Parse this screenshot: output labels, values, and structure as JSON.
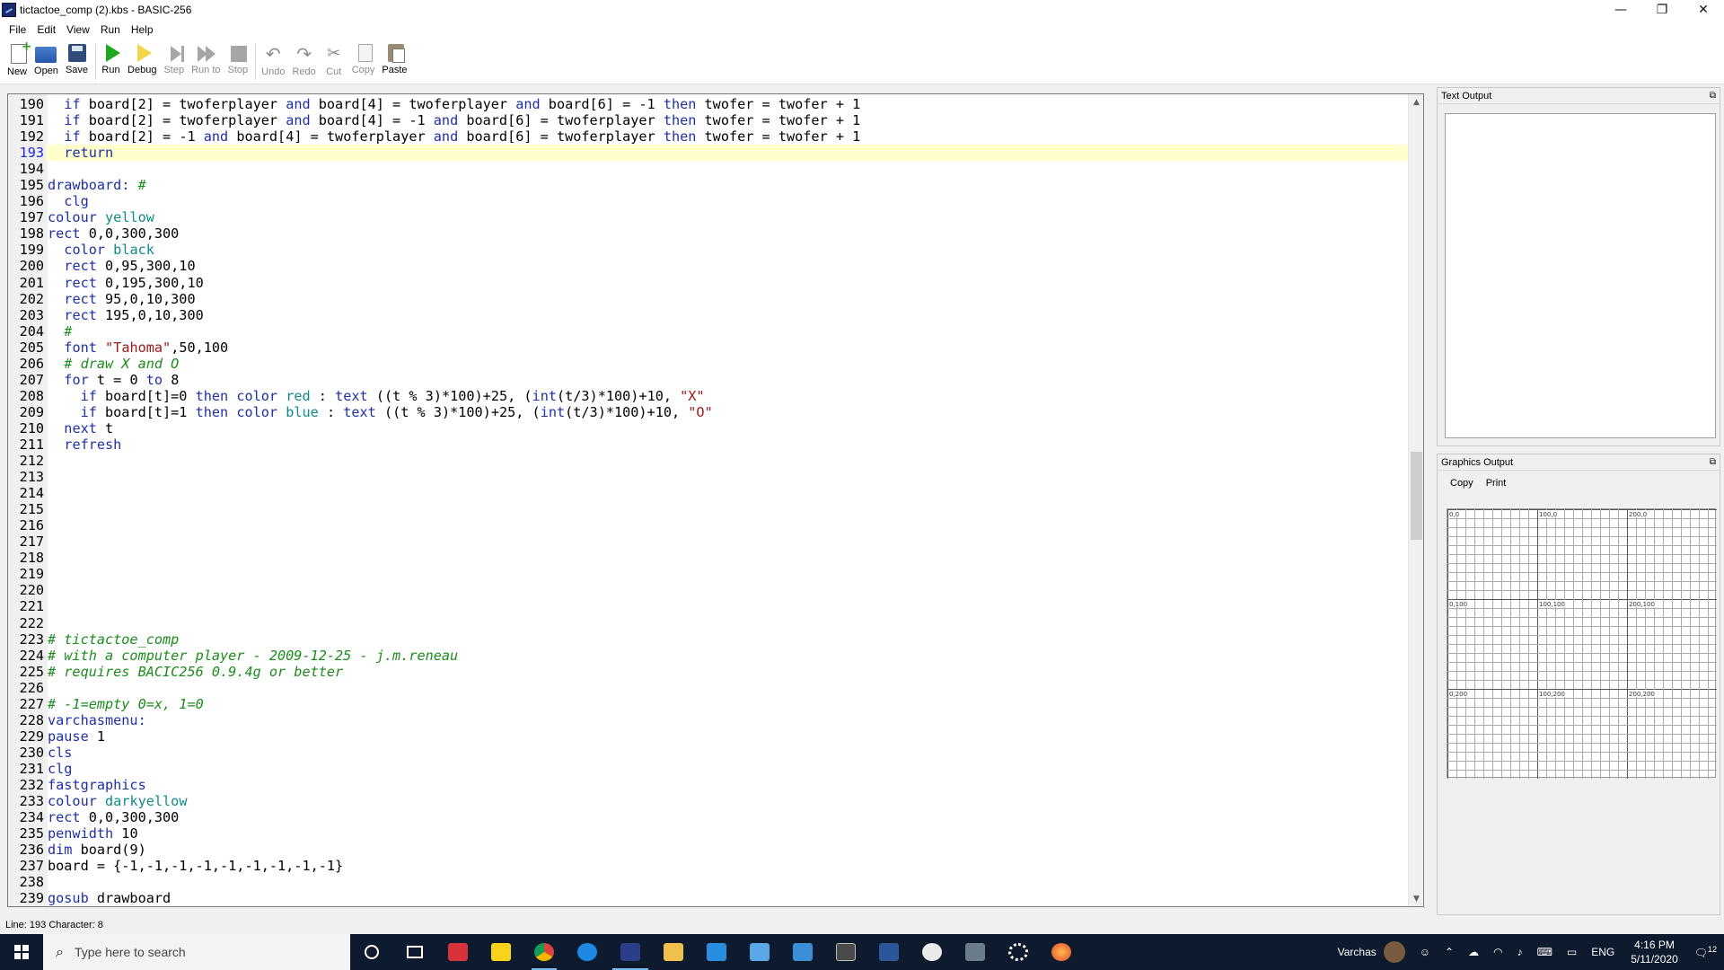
{
  "window": {
    "title": "tictactoe_comp (2).kbs - BASIC-256",
    "controls": [
      "—",
      "❐",
      "✕"
    ]
  },
  "menu": [
    "File",
    "Edit",
    "View",
    "Run",
    "Help"
  ],
  "toolbar": {
    "new": "New",
    "open": "Open",
    "save": "Save",
    "run": "Run",
    "debug": "Debug",
    "step": "Step",
    "run_to": "Run to",
    "stop": "Stop",
    "undo": "Undo",
    "redo": "Redo",
    "cut": "Cut",
    "copy": "Copy",
    "paste": "Paste"
  },
  "editor": {
    "current_line": 193,
    "lines": [
      {
        "n": "190",
        "code": [
          [
            "  ",
            ""
          ],
          [
            "if",
            "kw"
          ],
          [
            " board[2] = twoferplayer ",
            ""
          ],
          [
            "and",
            "kw"
          ],
          [
            " board[4] = twoferplayer ",
            ""
          ],
          [
            "and",
            "kw"
          ],
          [
            " board[6] = -1 ",
            ""
          ],
          [
            "then",
            "kw"
          ],
          [
            " twofer = twofer + 1",
            ""
          ]
        ]
      },
      {
        "n": "191",
        "code": [
          [
            "  ",
            ""
          ],
          [
            "if",
            "kw"
          ],
          [
            " board[2] = twoferplayer ",
            ""
          ],
          [
            "and",
            "kw"
          ],
          [
            " board[4] = -1 ",
            ""
          ],
          [
            "and",
            "kw"
          ],
          [
            " board[6] = twoferplayer ",
            ""
          ],
          [
            "then",
            "kw"
          ],
          [
            " twofer = twofer + 1",
            ""
          ]
        ]
      },
      {
        "n": "192",
        "code": [
          [
            "  ",
            ""
          ],
          [
            "if",
            "kw"
          ],
          [
            " board[2] = -1 ",
            ""
          ],
          [
            "and",
            "kw"
          ],
          [
            " board[4] = twoferplayer ",
            ""
          ],
          [
            "and",
            "kw"
          ],
          [
            " board[6] = twoferplayer ",
            ""
          ],
          [
            "then",
            "kw"
          ],
          [
            " twofer = twofer + 1",
            ""
          ]
        ]
      },
      {
        "n": "193",
        "code": [
          [
            "  ",
            ""
          ],
          [
            "return",
            "kw"
          ]
        ]
      },
      {
        "n": "194",
        "code": []
      },
      {
        "n": "195",
        "code": [
          [
            "drawboard:",
            "lb"
          ],
          [
            " ",
            ""
          ],
          [
            "#",
            "cm"
          ]
        ]
      },
      {
        "n": "196",
        "code": [
          [
            "  ",
            ""
          ],
          [
            "clg",
            "kw"
          ]
        ]
      },
      {
        "n": "197",
        "code": [
          [
            "colour",
            "kw"
          ],
          [
            " ",
            ""
          ],
          [
            "yellow",
            "cl"
          ]
        ]
      },
      {
        "n": "198",
        "code": [
          [
            "rect",
            "kw"
          ],
          [
            " 0,0,300,300",
            ""
          ]
        ]
      },
      {
        "n": "199",
        "code": [
          [
            "  ",
            ""
          ],
          [
            "color",
            "kw"
          ],
          [
            " ",
            ""
          ],
          [
            "black",
            "cl"
          ]
        ]
      },
      {
        "n": "200",
        "code": [
          [
            "  ",
            ""
          ],
          [
            "rect",
            "kw"
          ],
          [
            " 0,95,300,10",
            ""
          ]
        ]
      },
      {
        "n": "201",
        "code": [
          [
            "  ",
            ""
          ],
          [
            "rect",
            "kw"
          ],
          [
            " 0,195,300,10",
            ""
          ]
        ]
      },
      {
        "n": "202",
        "code": [
          [
            "  ",
            ""
          ],
          [
            "rect",
            "kw"
          ],
          [
            " 95,0,10,300",
            ""
          ]
        ]
      },
      {
        "n": "203",
        "code": [
          [
            "  ",
            ""
          ],
          [
            "rect",
            "kw"
          ],
          [
            " 195,0,10,300",
            ""
          ]
        ]
      },
      {
        "n": "204",
        "code": [
          [
            "  ",
            ""
          ],
          [
            "#",
            "cm"
          ]
        ]
      },
      {
        "n": "205",
        "code": [
          [
            "  ",
            ""
          ],
          [
            "font",
            "kw"
          ],
          [
            " ",
            ""
          ],
          [
            "\"Tahoma\"",
            "st"
          ],
          [
            ",50,100",
            ""
          ]
        ]
      },
      {
        "n": "206",
        "code": [
          [
            "  ",
            ""
          ],
          [
            "# draw X and O",
            "cm"
          ]
        ]
      },
      {
        "n": "207",
        "code": [
          [
            "  ",
            ""
          ],
          [
            "for",
            "kw"
          ],
          [
            " t = 0 ",
            ""
          ],
          [
            "to",
            "kw"
          ],
          [
            " 8",
            ""
          ]
        ]
      },
      {
        "n": "208",
        "code": [
          [
            "    ",
            ""
          ],
          [
            "if",
            "kw"
          ],
          [
            " board[t]=0 ",
            ""
          ],
          [
            "then",
            "kw"
          ],
          [
            " ",
            ""
          ],
          [
            "color",
            "kw"
          ],
          [
            " ",
            ""
          ],
          [
            "red",
            "cl"
          ],
          [
            " : ",
            ""
          ],
          [
            "text",
            "kw"
          ],
          [
            " ((t % 3)*100)+25, (",
            ""
          ],
          [
            "int",
            "kw"
          ],
          [
            "(t/3)*100)+10, ",
            ""
          ],
          [
            "\"X\"",
            "st"
          ]
        ]
      },
      {
        "n": "209",
        "code": [
          [
            "    ",
            ""
          ],
          [
            "if",
            "kw"
          ],
          [
            " board[t]=1 ",
            ""
          ],
          [
            "then",
            "kw"
          ],
          [
            " ",
            ""
          ],
          [
            "color",
            "kw"
          ],
          [
            " ",
            ""
          ],
          [
            "blue",
            "cl"
          ],
          [
            " : ",
            ""
          ],
          [
            "text",
            "kw"
          ],
          [
            " ((t % 3)*100)+25, (",
            ""
          ],
          [
            "int",
            "kw"
          ],
          [
            "(t/3)*100)+10, ",
            ""
          ],
          [
            "\"O\"",
            "st"
          ]
        ]
      },
      {
        "n": "210",
        "code": [
          [
            "  ",
            ""
          ],
          [
            "next",
            "kw"
          ],
          [
            " t",
            ""
          ]
        ]
      },
      {
        "n": "211",
        "code": [
          [
            "  ",
            ""
          ],
          [
            "refresh",
            "kw"
          ]
        ]
      },
      {
        "n": "212",
        "code": []
      },
      {
        "n": "213",
        "code": []
      },
      {
        "n": "214",
        "code": []
      },
      {
        "n": "215",
        "code": []
      },
      {
        "n": "216",
        "code": []
      },
      {
        "n": "217",
        "code": []
      },
      {
        "n": "218",
        "code": []
      },
      {
        "n": "219",
        "code": []
      },
      {
        "n": "220",
        "code": []
      },
      {
        "n": "221",
        "code": []
      },
      {
        "n": "222",
        "code": []
      },
      {
        "n": "223",
        "code": [
          [
            "# tictactoe_comp",
            "cm"
          ]
        ]
      },
      {
        "n": "224",
        "code": [
          [
            "# with a computer player - 2009-12-25 - j.m.reneau",
            "cm"
          ]
        ]
      },
      {
        "n": "225",
        "code": [
          [
            "# requires BACIC256 0.9.4g or better",
            "cm"
          ]
        ]
      },
      {
        "n": "226",
        "code": []
      },
      {
        "n": "227",
        "code": [
          [
            "# -1=empty 0=x, 1=0",
            "cm"
          ]
        ]
      },
      {
        "n": "228",
        "code": [
          [
            "varchasmenu:",
            "lb"
          ]
        ]
      },
      {
        "n": "229",
        "code": [
          [
            "pause",
            "kw"
          ],
          [
            " 1",
            ""
          ]
        ]
      },
      {
        "n": "230",
        "code": [
          [
            "cls",
            "kw"
          ]
        ]
      },
      {
        "n": "231",
        "code": [
          [
            "clg",
            "kw"
          ]
        ]
      },
      {
        "n": "232",
        "code": [
          [
            "fastgraphics",
            "kw"
          ]
        ]
      },
      {
        "n": "233",
        "code": [
          [
            "colour",
            "kw"
          ],
          [
            " ",
            ""
          ],
          [
            "darkyellow",
            "cl"
          ]
        ]
      },
      {
        "n": "234",
        "code": [
          [
            "rect",
            "kw"
          ],
          [
            " 0,0,300,300",
            ""
          ]
        ]
      },
      {
        "n": "235",
        "code": [
          [
            "penwidth",
            "kw"
          ],
          [
            " 10",
            ""
          ]
        ]
      },
      {
        "n": "236",
        "code": [
          [
            "dim",
            "kw"
          ],
          [
            " board(9)",
            ""
          ]
        ]
      },
      {
        "n": "237",
        "code": [
          [
            "board = {-1,-1,-1,-1,-1,-1,-1,-1,-1}",
            ""
          ]
        ]
      },
      {
        "n": "238",
        "code": []
      },
      {
        "n": "239",
        "code": [
          [
            "gosub",
            "kw"
          ],
          [
            " drawboard",
            ""
          ]
        ]
      }
    ]
  },
  "status": "Line: 193 Character: 8",
  "text_output": {
    "title": "Text Output"
  },
  "graphics_output": {
    "title": "Graphics Output",
    "copy": "Copy",
    "print": "Print",
    "grid_labels": [
      "0,0",
      "100,0",
      "200,0",
      "0,100",
      "100,100",
      "200,100",
      "0,200",
      "100,200",
      "200,200"
    ]
  },
  "taskbar": {
    "search_placeholder": "Type here to search",
    "user": "Varchas",
    "language": "ENG",
    "time": "4:16 PM",
    "date": "5/11/2020",
    "notification_count": "12"
  }
}
